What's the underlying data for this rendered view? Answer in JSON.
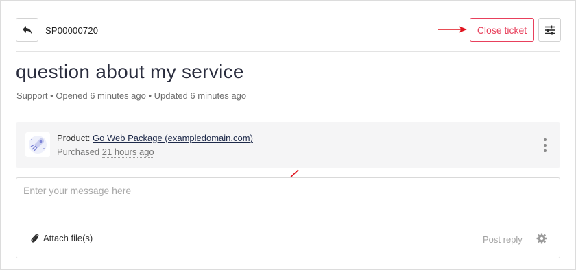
{
  "header": {
    "ticket_id": "SP00000720",
    "close_label": "Close ticket",
    "back_icon": "reply-arrow-icon",
    "settings_icon": "sliders-icon"
  },
  "ticket": {
    "title": "question about my service",
    "department": "Support",
    "sep1": " • Opened ",
    "opened": "6 minutes ago",
    "sep2": " • Updated ",
    "updated": "6 minutes ago"
  },
  "product": {
    "prefix": "Product: ",
    "name": "Go Web Package (exampledomain.com)",
    "purchased_prefix": "Purchased ",
    "purchased": "21 hours ago",
    "thumb_icon": "rocket-illustration-icon",
    "menu_icon": "kebab-menu-icon"
  },
  "reply": {
    "placeholder": "Enter your message here",
    "attach_label": "Attach file(s)",
    "post_label": "Post reply",
    "attach_icon": "paperclip-icon",
    "options_icon": "gear-icon"
  },
  "colors": {
    "accent_red": "#e8405c",
    "annotation_red": "#e0141e",
    "title_text": "#2a2d3e",
    "panel_bg": "#f5f5f6"
  }
}
